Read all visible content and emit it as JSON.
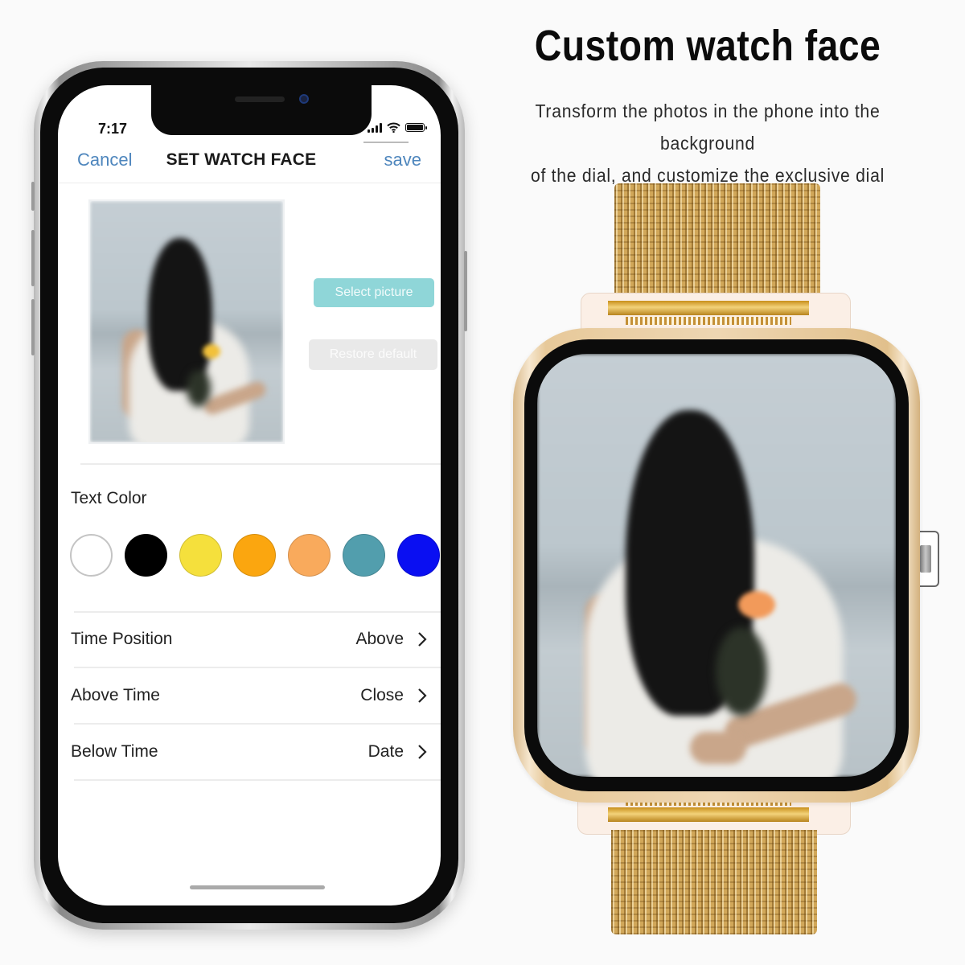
{
  "phone": {
    "status_bar": {
      "time": "7:17",
      "signal_icon": "cellular-signal-icon",
      "wifi_icon": "wifi-icon",
      "battery_icon": "battery-icon"
    },
    "nav": {
      "cancel_label": "Cancel",
      "title": "SET WATCH FACE",
      "save_label": "save",
      "link_color": "#4e86bd"
    },
    "preview": {
      "image_description": "Blurred photo of woman with long dark hair in white dress holding a flower, seaside"
    },
    "buttons": {
      "select_picture": "Select picture",
      "restore_default": "Restore default",
      "select_color": "#8fd6d8",
      "restore_color": "#e9e9e9"
    },
    "text_color": {
      "label": "Text Color",
      "swatches": [
        {
          "name": "white",
          "color": "#ffffff"
        },
        {
          "name": "black",
          "color": "#000000"
        },
        {
          "name": "yellow",
          "color": "#f5e03c"
        },
        {
          "name": "orange",
          "color": "#fba60f"
        },
        {
          "name": "light-orange",
          "color": "#f9aa5c"
        },
        {
          "name": "teal",
          "color": "#529ead"
        },
        {
          "name": "blue",
          "color": "#0a0ff2"
        }
      ]
    },
    "settings": [
      {
        "label": "Time Position",
        "value": "Above"
      },
      {
        "label": "Above Time",
        "value": "Close"
      },
      {
        "label": "Below Time",
        "value": "Date"
      }
    ]
  },
  "marketing": {
    "headline": "Custom watch face",
    "subhead_line1": "Transform the photos in the phone into the background",
    "subhead_line2": "of the dial, and customize the exclusive dial"
  },
  "watch": {
    "finish": "gold",
    "band": "milanese-mesh",
    "screen_image_description": "Same photo set as watch face background"
  }
}
